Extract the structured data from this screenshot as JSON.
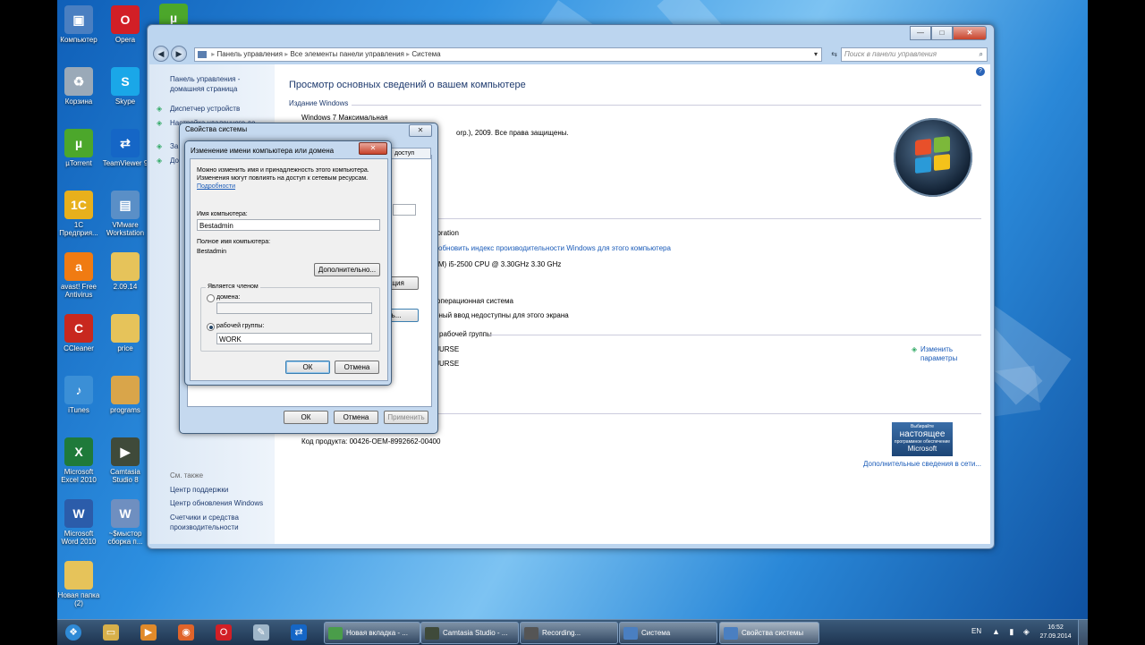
{
  "desktop_icons": [
    {
      "label": "Компьютер",
      "icon": "computer-icon",
      "color": "#4a7fc1"
    },
    {
      "label": "Opera",
      "icon": "opera-icon",
      "color": "#d21f26"
    },
    {
      "label": "Корзина",
      "icon": "recycle-bin-icon",
      "color": "#9aa9b8"
    },
    {
      "label": "Skype",
      "icon": "skype-icon",
      "color": "#1aa7e8"
    },
    {
      "label": "µTorrent",
      "icon": "utorrent-icon",
      "color": "#4ca72b"
    },
    {
      "label": "TeamViewer 9",
      "icon": "teamviewer-icon",
      "color": "#1566c6"
    },
    {
      "label": "1С Предприя...",
      "icon": "1c-icon",
      "color": "#e8b01c"
    },
    {
      "label": "VMware Workstation",
      "icon": "vmware-icon",
      "color": "#5a8fc7"
    },
    {
      "label": "avast! Free Antivirus",
      "icon": "avast-icon",
      "color": "#f07b12"
    },
    {
      "label": "2.09.14",
      "icon": "folder-icon",
      "color": "#e6c35a"
    },
    {
      "label": "CCleaner",
      "icon": "ccleaner-icon",
      "color": "#c8281e"
    },
    {
      "label": "price",
      "icon": "folder-icon",
      "color": "#e6c35a"
    },
    {
      "label": "iTunes",
      "icon": "itunes-icon",
      "color": "#3b8fd6"
    },
    {
      "label": "programs",
      "icon": "folder-icon",
      "color": "#d9a54a"
    },
    {
      "label": "Microsoft Excel 2010",
      "icon": "excel-icon",
      "color": "#1f7a3a"
    },
    {
      "label": "Camtasia Studio 8",
      "icon": "camtasia-icon",
      "color": "#3f4a3a"
    },
    {
      "label": "Microsoft Word 2010",
      "icon": "word-icon",
      "color": "#2b5caa"
    },
    {
      "label": "~$мыстор сборка п...",
      "icon": "word-doc-icon",
      "color": "#6f8fc0"
    },
    {
      "label": "Новая папка (2)",
      "icon": "folder-icon",
      "color": "#e6c35a"
    }
  ],
  "window": {
    "breadcrumb": [
      "Панель управления",
      "Все элементы панели управления",
      "Система"
    ],
    "search_placeholder": "Поиск в панели управления",
    "help": "?",
    "min": "—",
    "max": "□",
    "close": "✕",
    "left_pane": {
      "home": "Панель управления -\nдомашняя страница",
      "links": [
        "Диспетчер устройств",
        "Настройка удаленного до...",
        "За...",
        "До..."
      ],
      "see_also_title": "См. также",
      "see_also": [
        "Центр поддержки",
        "Центр обновления Windows",
        "Счетчики и средства\nпроизводительности"
      ]
    },
    "main": {
      "title": "Просмотр основных сведений о вашем компьютере",
      "edition_header": "Издание Windows",
      "edition": "Windows 7 Максимальная",
      "copyright": "orp.), 2009. Все права защищены.",
      "manufacturer_frag": "poration",
      "perf_link": "обновить индекс производительности Windows для этого компьютера",
      "cpu_frag": "TM) i5-2500 CPU @ 3.30GHz   3.30 GHz",
      "os_type_frag": "операционная система",
      "pen_frag": "рный ввод недоступны для этого экрана",
      "workgroup_section_frag": "рабочей группы",
      "name_frag1": "JURSE",
      "name_frag2": "JURSE",
      "change_settings": "Изменить\nпараметры",
      "product_id": "Код продукта: 00426-OEM-8992662-00400",
      "genuine_line1": "Выбирайте",
      "genuine_line2": "настоящее",
      "genuine_line3": "программное обеспечение",
      "genuine_line4": "Microsoft",
      "more_info_link": "Дополнительные сведения в сети..."
    }
  },
  "sysprops": {
    "title": "Свойства системы",
    "close": "✕",
    "tab_frag": "доступ",
    "btn_frag1": "ация",
    "btn_frag2": "ть...",
    "ok": "ОК",
    "cancel": "Отмена",
    "apply": "Применить"
  },
  "rename_dialog": {
    "title": "Изменение имени компьютера или домена",
    "close": "✕",
    "description": "Можно изменить имя и принадлежность этого компьютера. Изменения могут повлиять на доступ к сетевым ресурсам.",
    "details_link": "Подробности",
    "name_label": "Имя компьютера:",
    "name_value": "Bestadmin",
    "full_name_label": "Полное имя компьютера:",
    "full_name_value": "Bestadmin",
    "more_button": "Дополнительно...",
    "member_of_label": "Является членом",
    "domain_label": "домена:",
    "domain_value": "",
    "workgroup_label": "рабочей группы:",
    "workgroup_value": "WORK",
    "ok": "ОК",
    "cancel": "Отмена"
  },
  "taskbar": {
    "pinned": [
      "start-orb-icon",
      "explorer-icon",
      "media-player-icon",
      "firefox-icon",
      "opera-icon",
      "notepad-icon",
      "teamviewer-icon"
    ],
    "tasks": [
      {
        "label": "Новая вкладка - ...",
        "icon": "chrome-icon",
        "color": "#4a9d4a"
      },
      {
        "label": "Camtasia Studio - ...",
        "icon": "camtasia-icon",
        "color": "#3f4a3a"
      },
      {
        "label": "Recording...",
        "icon": "recording-icon",
        "color": "#555"
      },
      {
        "label": "Система",
        "icon": "system-icon",
        "color": "#4a7fc1"
      },
      {
        "label": "Свойства системы",
        "icon": "system-icon",
        "color": "#4a7fc1"
      }
    ],
    "lang": "EN",
    "time": "16:52",
    "date": "27.09.2014"
  }
}
